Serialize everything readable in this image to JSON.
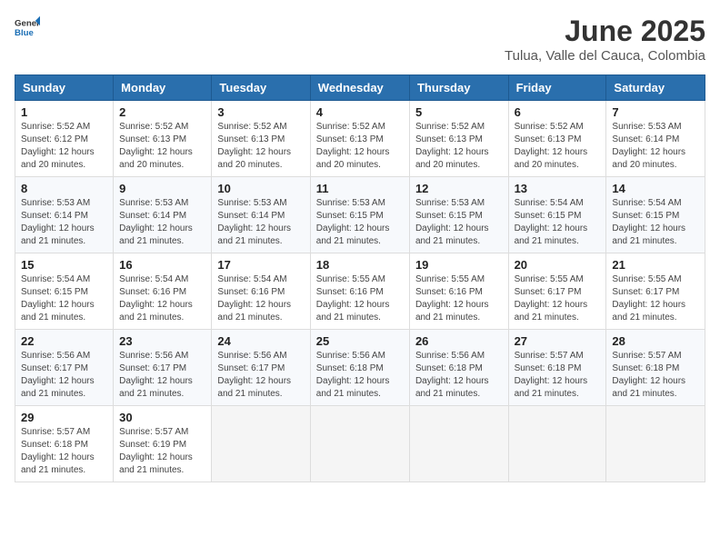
{
  "logo": {
    "general": "General",
    "blue": "Blue"
  },
  "title": {
    "month": "June 2025",
    "location": "Tulua, Valle del Cauca, Colombia"
  },
  "days_of_week": [
    "Sunday",
    "Monday",
    "Tuesday",
    "Wednesday",
    "Thursday",
    "Friday",
    "Saturday"
  ],
  "weeks": [
    [
      {
        "day": "1",
        "sunrise": "Sunrise: 5:52 AM",
        "sunset": "Sunset: 6:12 PM",
        "daylight": "Daylight: 12 hours and 20 minutes."
      },
      {
        "day": "2",
        "sunrise": "Sunrise: 5:52 AM",
        "sunset": "Sunset: 6:13 PM",
        "daylight": "Daylight: 12 hours and 20 minutes."
      },
      {
        "day": "3",
        "sunrise": "Sunrise: 5:52 AM",
        "sunset": "Sunset: 6:13 PM",
        "daylight": "Daylight: 12 hours and 20 minutes."
      },
      {
        "day": "4",
        "sunrise": "Sunrise: 5:52 AM",
        "sunset": "Sunset: 6:13 PM",
        "daylight": "Daylight: 12 hours and 20 minutes."
      },
      {
        "day": "5",
        "sunrise": "Sunrise: 5:52 AM",
        "sunset": "Sunset: 6:13 PM",
        "daylight": "Daylight: 12 hours and 20 minutes."
      },
      {
        "day": "6",
        "sunrise": "Sunrise: 5:52 AM",
        "sunset": "Sunset: 6:13 PM",
        "daylight": "Daylight: 12 hours and 20 minutes."
      },
      {
        "day": "7",
        "sunrise": "Sunrise: 5:53 AM",
        "sunset": "Sunset: 6:14 PM",
        "daylight": "Daylight: 12 hours and 20 minutes."
      }
    ],
    [
      {
        "day": "8",
        "sunrise": "Sunrise: 5:53 AM",
        "sunset": "Sunset: 6:14 PM",
        "daylight": "Daylight: 12 hours and 21 minutes."
      },
      {
        "day": "9",
        "sunrise": "Sunrise: 5:53 AM",
        "sunset": "Sunset: 6:14 PM",
        "daylight": "Daylight: 12 hours and 21 minutes."
      },
      {
        "day": "10",
        "sunrise": "Sunrise: 5:53 AM",
        "sunset": "Sunset: 6:14 PM",
        "daylight": "Daylight: 12 hours and 21 minutes."
      },
      {
        "day": "11",
        "sunrise": "Sunrise: 5:53 AM",
        "sunset": "Sunset: 6:15 PM",
        "daylight": "Daylight: 12 hours and 21 minutes."
      },
      {
        "day": "12",
        "sunrise": "Sunrise: 5:53 AM",
        "sunset": "Sunset: 6:15 PM",
        "daylight": "Daylight: 12 hours and 21 minutes."
      },
      {
        "day": "13",
        "sunrise": "Sunrise: 5:54 AM",
        "sunset": "Sunset: 6:15 PM",
        "daylight": "Daylight: 12 hours and 21 minutes."
      },
      {
        "day": "14",
        "sunrise": "Sunrise: 5:54 AM",
        "sunset": "Sunset: 6:15 PM",
        "daylight": "Daylight: 12 hours and 21 minutes."
      }
    ],
    [
      {
        "day": "15",
        "sunrise": "Sunrise: 5:54 AM",
        "sunset": "Sunset: 6:15 PM",
        "daylight": "Daylight: 12 hours and 21 minutes."
      },
      {
        "day": "16",
        "sunrise": "Sunrise: 5:54 AM",
        "sunset": "Sunset: 6:16 PM",
        "daylight": "Daylight: 12 hours and 21 minutes."
      },
      {
        "day": "17",
        "sunrise": "Sunrise: 5:54 AM",
        "sunset": "Sunset: 6:16 PM",
        "daylight": "Daylight: 12 hours and 21 minutes."
      },
      {
        "day": "18",
        "sunrise": "Sunrise: 5:55 AM",
        "sunset": "Sunset: 6:16 PM",
        "daylight": "Daylight: 12 hours and 21 minutes."
      },
      {
        "day": "19",
        "sunrise": "Sunrise: 5:55 AM",
        "sunset": "Sunset: 6:16 PM",
        "daylight": "Daylight: 12 hours and 21 minutes."
      },
      {
        "day": "20",
        "sunrise": "Sunrise: 5:55 AM",
        "sunset": "Sunset: 6:17 PM",
        "daylight": "Daylight: 12 hours and 21 minutes."
      },
      {
        "day": "21",
        "sunrise": "Sunrise: 5:55 AM",
        "sunset": "Sunset: 6:17 PM",
        "daylight": "Daylight: 12 hours and 21 minutes."
      }
    ],
    [
      {
        "day": "22",
        "sunrise": "Sunrise: 5:56 AM",
        "sunset": "Sunset: 6:17 PM",
        "daylight": "Daylight: 12 hours and 21 minutes."
      },
      {
        "day": "23",
        "sunrise": "Sunrise: 5:56 AM",
        "sunset": "Sunset: 6:17 PM",
        "daylight": "Daylight: 12 hours and 21 minutes."
      },
      {
        "day": "24",
        "sunrise": "Sunrise: 5:56 AM",
        "sunset": "Sunset: 6:17 PM",
        "daylight": "Daylight: 12 hours and 21 minutes."
      },
      {
        "day": "25",
        "sunrise": "Sunrise: 5:56 AM",
        "sunset": "Sunset: 6:18 PM",
        "daylight": "Daylight: 12 hours and 21 minutes."
      },
      {
        "day": "26",
        "sunrise": "Sunrise: 5:56 AM",
        "sunset": "Sunset: 6:18 PM",
        "daylight": "Daylight: 12 hours and 21 minutes."
      },
      {
        "day": "27",
        "sunrise": "Sunrise: 5:57 AM",
        "sunset": "Sunset: 6:18 PM",
        "daylight": "Daylight: 12 hours and 21 minutes."
      },
      {
        "day": "28",
        "sunrise": "Sunrise: 5:57 AM",
        "sunset": "Sunset: 6:18 PM",
        "daylight": "Daylight: 12 hours and 21 minutes."
      }
    ],
    [
      {
        "day": "29",
        "sunrise": "Sunrise: 5:57 AM",
        "sunset": "Sunset: 6:18 PM",
        "daylight": "Daylight: 12 hours and 21 minutes."
      },
      {
        "day": "30",
        "sunrise": "Sunrise: 5:57 AM",
        "sunset": "Sunset: 6:19 PM",
        "daylight": "Daylight: 12 hours and 21 minutes."
      },
      null,
      null,
      null,
      null,
      null
    ]
  ]
}
